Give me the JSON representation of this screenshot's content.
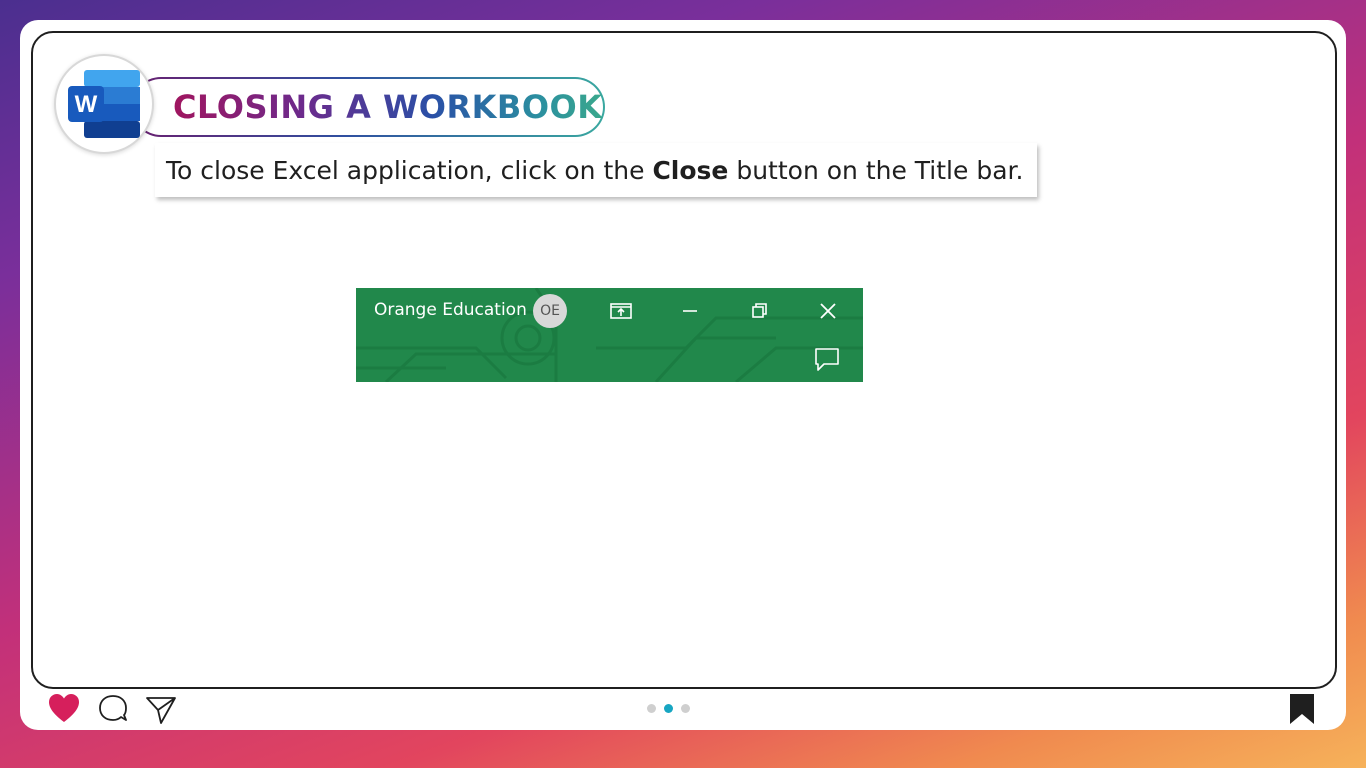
{
  "slide": {
    "title": "CLOSING A WORKBOOK",
    "instruction": {
      "before": "To close Excel application, click on the ",
      "bold": "Close",
      "after": " button on the Title bar."
    }
  },
  "logo": {
    "icon": "word-logo-icon",
    "letter": "W"
  },
  "excel_titlebar": {
    "user_name": "Orange Education",
    "avatar_initials": "OE",
    "controls": [
      "ribbon-display-options-icon",
      "minimize-icon",
      "restore-icon",
      "close-icon"
    ],
    "comments_icon": "comments-icon",
    "background_color": "#21884b"
  },
  "footer": {
    "icons": [
      "heart-icon",
      "comment-bubble-icon",
      "send-icon",
      "bookmark-icon"
    ],
    "pagination": {
      "total": 3,
      "active": 2
    },
    "heart_color": "#d61f5c",
    "active_dot_color": "#17a6c2"
  }
}
